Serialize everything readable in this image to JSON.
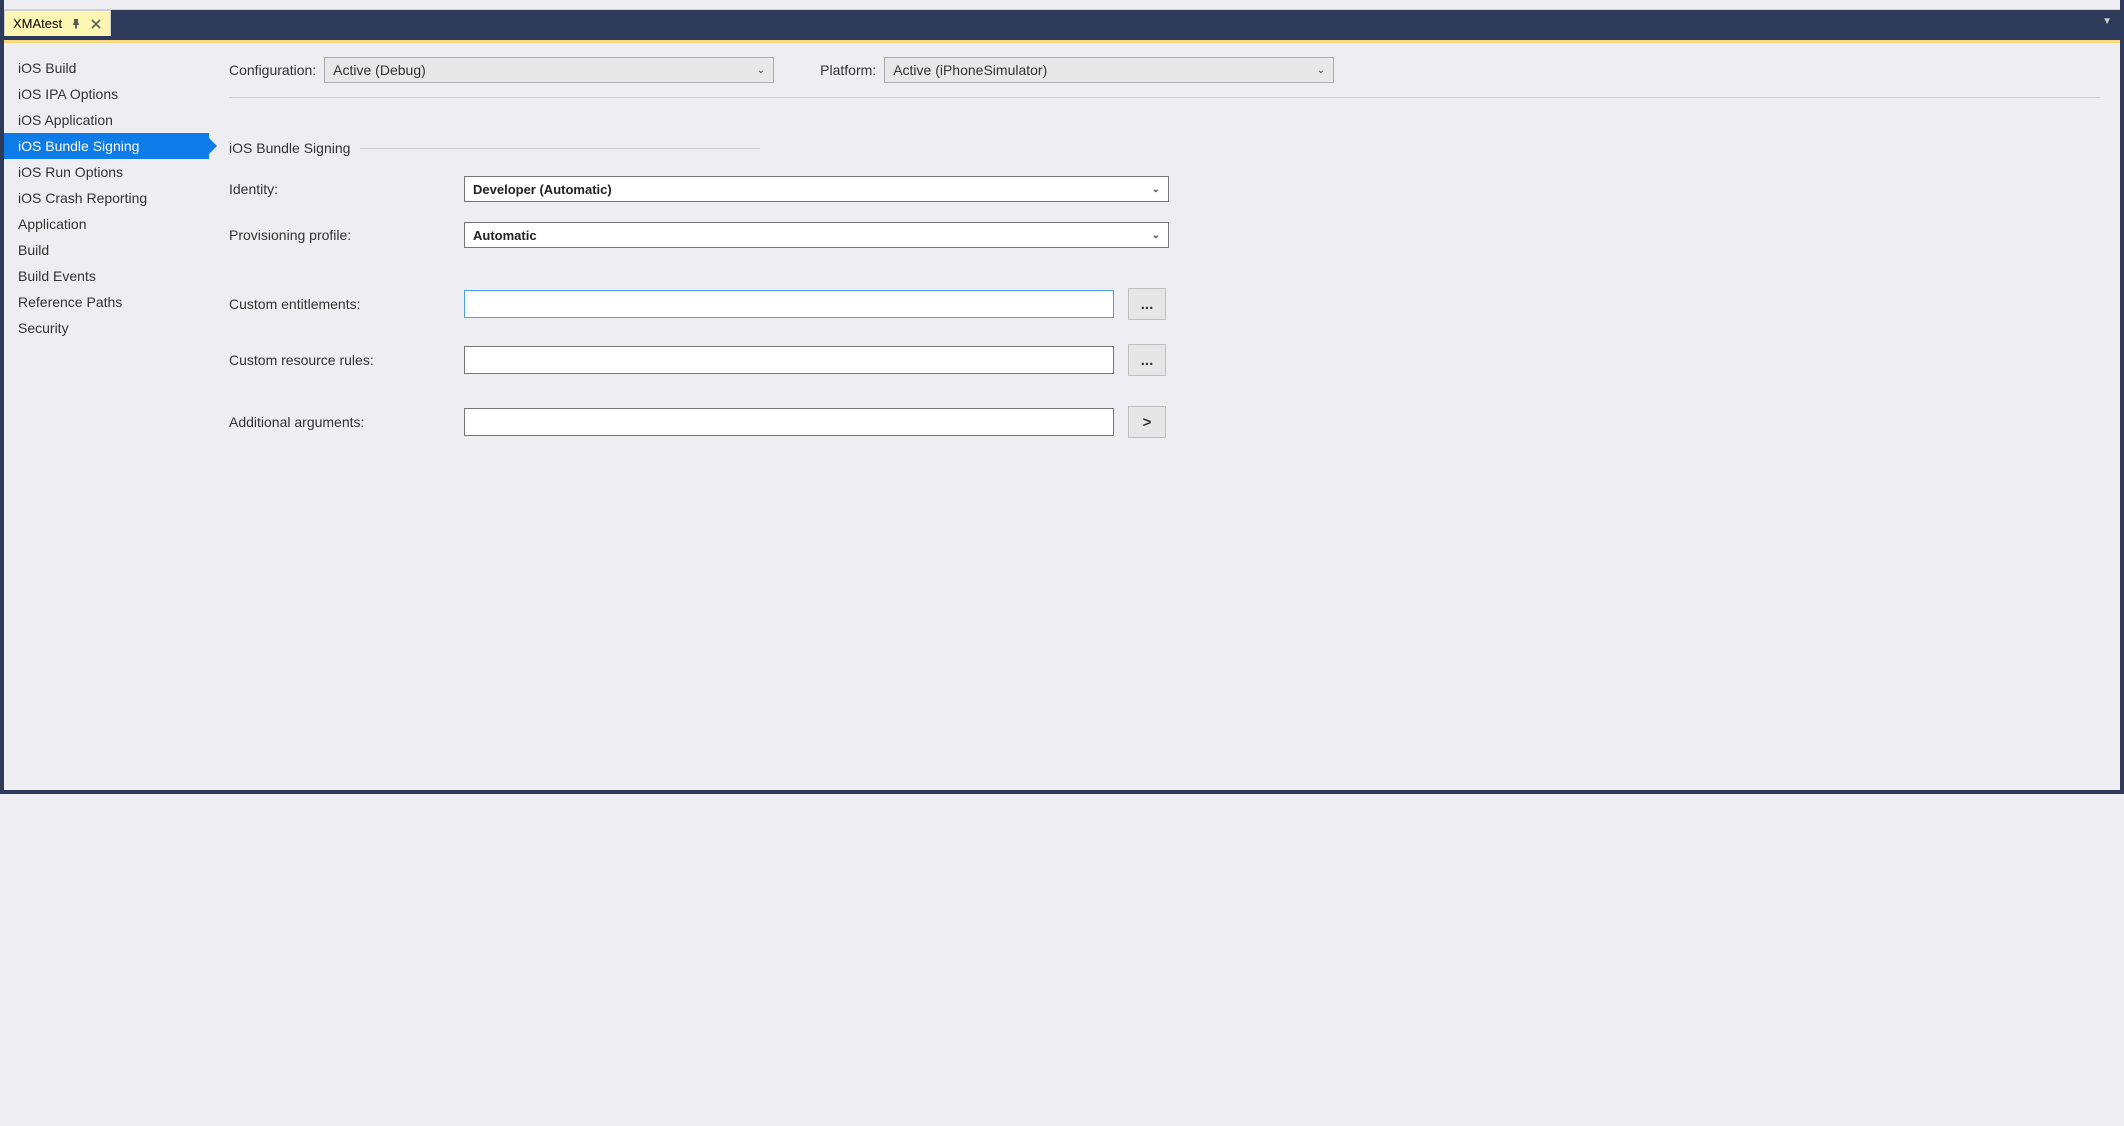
{
  "tab": {
    "title": "XMAtest"
  },
  "sidebar": {
    "items": [
      {
        "label": "iOS Build"
      },
      {
        "label": "iOS IPA Options"
      },
      {
        "label": "iOS Application"
      },
      {
        "label": "iOS Bundle Signing"
      },
      {
        "label": "iOS Run Options"
      },
      {
        "label": "iOS Crash Reporting"
      },
      {
        "label": "Application"
      },
      {
        "label": "Build"
      },
      {
        "label": "Build Events"
      },
      {
        "label": "Reference Paths"
      },
      {
        "label": "Security"
      }
    ]
  },
  "header": {
    "config_label": "Configuration:",
    "config_value": "Active (Debug)",
    "platform_label": "Platform:",
    "platform_value": "Active (iPhoneSimulator)"
  },
  "section": {
    "title": "iOS Bundle Signing"
  },
  "form": {
    "identity_label": "Identity:",
    "identity_value": "Developer (Automatic)",
    "provisioning_label": "Provisioning profile:",
    "provisioning_value": "Automatic",
    "entitlements_label": "Custom entitlements:",
    "entitlements_value": "",
    "rules_label": "Custom resource rules:",
    "rules_value": "",
    "args_label": "Additional arguments:",
    "args_value": "",
    "browse_glyph": "...",
    "more_glyph": ">"
  }
}
